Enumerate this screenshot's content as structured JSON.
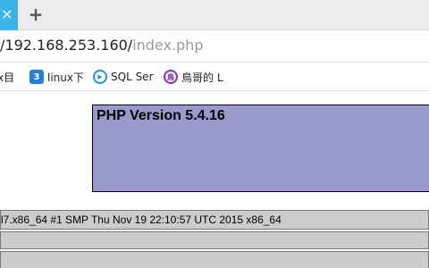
{
  "tabs": {
    "active_close_glyph": "×",
    "new_tab_glyph": "+",
    "active_color": "#3db4e6"
  },
  "address_bar": {
    "url_host": "/192.168.253.160/",
    "url_path": "index.php"
  },
  "bookmarks": [
    {
      "label": "x目",
      "icon": "generic-icon"
    },
    {
      "label": "linux下",
      "icon": "blue-square-icon",
      "icon_glyph": "3"
    },
    {
      "label": "SQL Ser",
      "icon": "play-circle-icon",
      "icon_glyph": "▶"
    },
    {
      "label": "鳥哥的 L",
      "icon": "seal-icon",
      "icon_glyph": "鳥"
    }
  ],
  "page": {
    "php_version": "PHP Version 5.4.16",
    "header_color": "#9999cc",
    "system_info": "l7.x86_64 #1 SMP Thu Nov 19 22:10:57 UTC 2015 x86_64"
  }
}
